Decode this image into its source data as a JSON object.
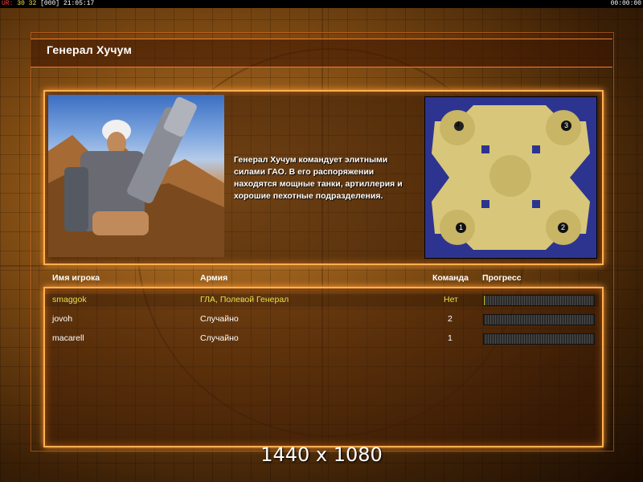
{
  "hud": {
    "left_prefix": "UR:",
    "left_a": "30",
    "left_b": "32",
    "left_c": "[000]",
    "left_time": "21:05:17",
    "right_time": "00:00:00"
  },
  "title": "Генерал Хучум",
  "description": "Генерал Хучум командует элитными силами ГАО. В его распоряжении находятся мощные танки, артиллерия и хорошие пехотные подразделения.",
  "map": {
    "start_positions": [
      "1",
      "2",
      "3",
      "4"
    ]
  },
  "table": {
    "headers": {
      "player": "Имя игрока",
      "army": "Армия",
      "team": "Команда",
      "progress": "Прогресс"
    },
    "rows": [
      {
        "player": "smaggok",
        "army": "ГЛА, Полевой Генерал",
        "team": "Нет",
        "progress": 0.01
      },
      {
        "player": "jovoh",
        "army": "Случайно",
        "team": "2",
        "progress": 0
      },
      {
        "player": "macarell",
        "army": "Случайно",
        "team": "1",
        "progress": 0
      }
    ]
  },
  "resolution_label": "1440 x 1080",
  "colors": {
    "accent": "#ffb050",
    "selected_text": "#e8e04a",
    "hud_red": "#ff3b3b",
    "hud_yellow": "#f3e04b"
  }
}
